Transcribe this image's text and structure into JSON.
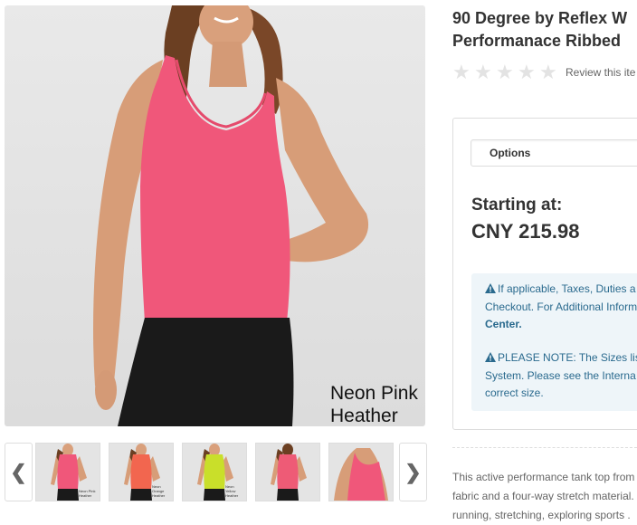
{
  "product": {
    "title_line1": "90 Degree by Reflex W",
    "title_line2": "Performanace Ribbed",
    "review_link": "Review this ite",
    "rating": 0,
    "rating_max": 5,
    "main_image": {
      "caption_line1": "Neon Pink",
      "caption_line2": "Heather"
    }
  },
  "thumbnails": [
    {
      "color": "#f0577a",
      "label": "Neon Pink Heather"
    },
    {
      "color": "#f2664f",
      "label": "Neon Orange Heather"
    },
    {
      "color": "#c9df2a",
      "label": "Neon Yellow Heather"
    },
    {
      "color": "#ee5b76",
      "label": ""
    },
    {
      "color": "#f0577a",
      "label": ""
    }
  ],
  "buy_box": {
    "options_label": "Options",
    "starting_label": "Starting at:",
    "price": "CNY 215.98"
  },
  "notice": {
    "line1": "If applicable, Taxes, Duties a",
    "line2": "Checkout. For Additional Inform",
    "line3": "Center.",
    "line4": "PLEASE NOTE: The Sizes lis",
    "line5": "System. Please see the Interna",
    "line6": "correct size."
  },
  "description": {
    "line1": "This active performance tank top from",
    "line2": "fabric and a four-way stretch material.",
    "line3": "running, stretching, exploring sports ."
  },
  "colors": {
    "notice_text": "#2a6a8e",
    "notice_bg": "#eef5f9",
    "tank_pink": "#f0577a",
    "leggings": "#1a1a1a"
  }
}
